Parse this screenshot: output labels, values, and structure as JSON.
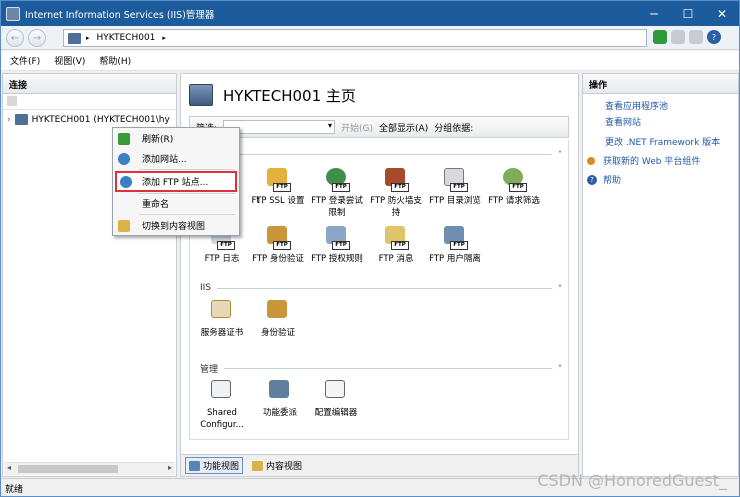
{
  "window": {
    "title": "Internet Information Services (IIS)管理器",
    "controls": [
      "─",
      "☐",
      "✕"
    ]
  },
  "address": {
    "back": "←",
    "forward": "→",
    "path_node": "HYKTECH001",
    "sep1": "▸",
    "sep2": "▸"
  },
  "menubar": {
    "items": [
      "文件(F)",
      "视图(V)",
      "帮助(H)"
    ]
  },
  "connections": {
    "title": "连接",
    "tree_expander": "›",
    "tree_item": "HYKTECH001 (HYKTECH001\\hy"
  },
  "main": {
    "title": "HYKTECH001 主页",
    "filter": {
      "label": "筛选:",
      "go": "开始(G)",
      "show_all": "全部显示(A)",
      "group_by": "分组依据:"
    },
    "ftp_row1": [
      "FTP SSL 设置",
      "FTP 登录尝试限制",
      "FTP 防火墙支持",
      "FTP 目录浏览",
      "FTP 请求筛选"
    ],
    "ftp_partial_label": "t",
    "ftp_row2": [
      "FTP 日志",
      "FTP 身份验证",
      "FTP 授权规则",
      "FTP 消息",
      "FTP 用户隔离"
    ],
    "iis_group": "IIS",
    "iis_items": [
      "服务器证书",
      "身份验证"
    ],
    "mgmt_group": "管理",
    "mgmt_items": [
      "Shared Configur...",
      "功能委派",
      "配置编辑器"
    ],
    "views": {
      "features": "功能视图",
      "content": "内容视图"
    }
  },
  "actions": {
    "title": "操作",
    "items": [
      "查看应用程序池",
      "查看网站",
      "更改 .NET Framework 版本",
      "获取新的 Web 平台组件",
      "帮助"
    ]
  },
  "context_menu": {
    "items": [
      "刷新(R)",
      "添加网站...",
      "添加 FTP 站点...",
      "重命名",
      "切换到内容视图"
    ]
  },
  "status": {
    "text": "就绪"
  },
  "watermark": "CSDN @HonoredGuest_"
}
